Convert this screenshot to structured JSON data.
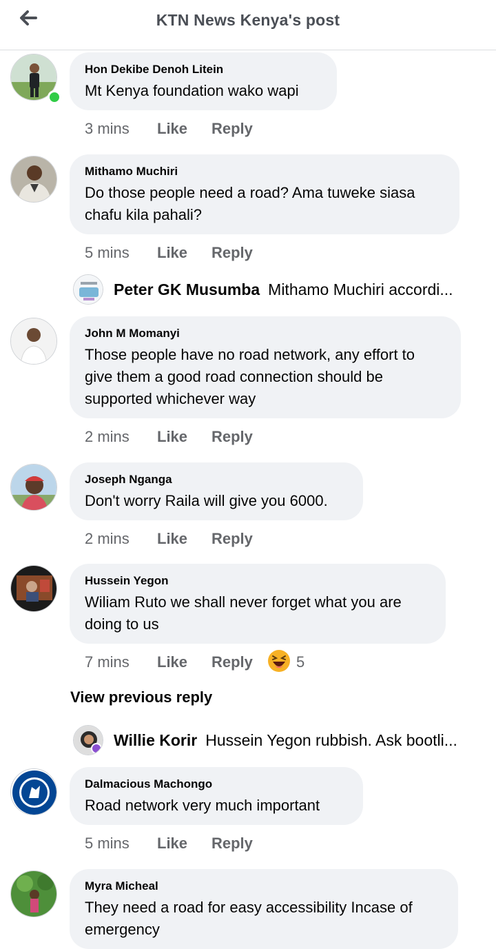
{
  "header": {
    "title": "KTN News Kenya's post",
    "back_icon": "back-arrow-icon"
  },
  "actions": {
    "like": "Like",
    "reply": "Reply"
  },
  "comments": [
    {
      "author": "Hon Dekibe Denoh Litein",
      "text": "Mt Kenya foundation wako wapi",
      "time": "3 mins"
    },
    {
      "author": "Mithamo Muchiri",
      "text": "Do those people need a road? Ama tuweke siasa chafu kila pahali?",
      "time": "5 mins"
    },
    {
      "author": "John M Momanyi",
      "text": "Those people have no road network, any effort to give them a good road connection should be supported whichever way",
      "time": "2 mins"
    },
    {
      "author": "Joseph Nganga",
      "text": "Don't worry Raila will give you 6000.",
      "time": "2 mins"
    },
    {
      "author": "Hussein Yegon",
      "text": "Wiliam Ruto we shall never forget what you are doing to us",
      "time": "7 mins",
      "reaction": {
        "icon": "haha-emoji-icon",
        "count": "5"
      }
    },
    {
      "author": "Dalmacious Machongo",
      "text": "Road network very much important",
      "time": "5 mins"
    },
    {
      "author": "Myra Micheal",
      "text": "They need a road for easy accessibility Incase of emergency"
    }
  ],
  "replies": [
    {
      "author": "Peter GK Musumba",
      "text": "Mithamo Muchiri accordi..."
    },
    {
      "author": "Willie Korir",
      "text": "Hussein Yegon rubbish. Ask bootli..."
    }
  ],
  "view_previous": "View previous reply",
  "colors": {
    "bubble": "#f0f2f5",
    "meta": "#65676b",
    "online": "#31cc46",
    "header_title": "#4b4f56"
  }
}
